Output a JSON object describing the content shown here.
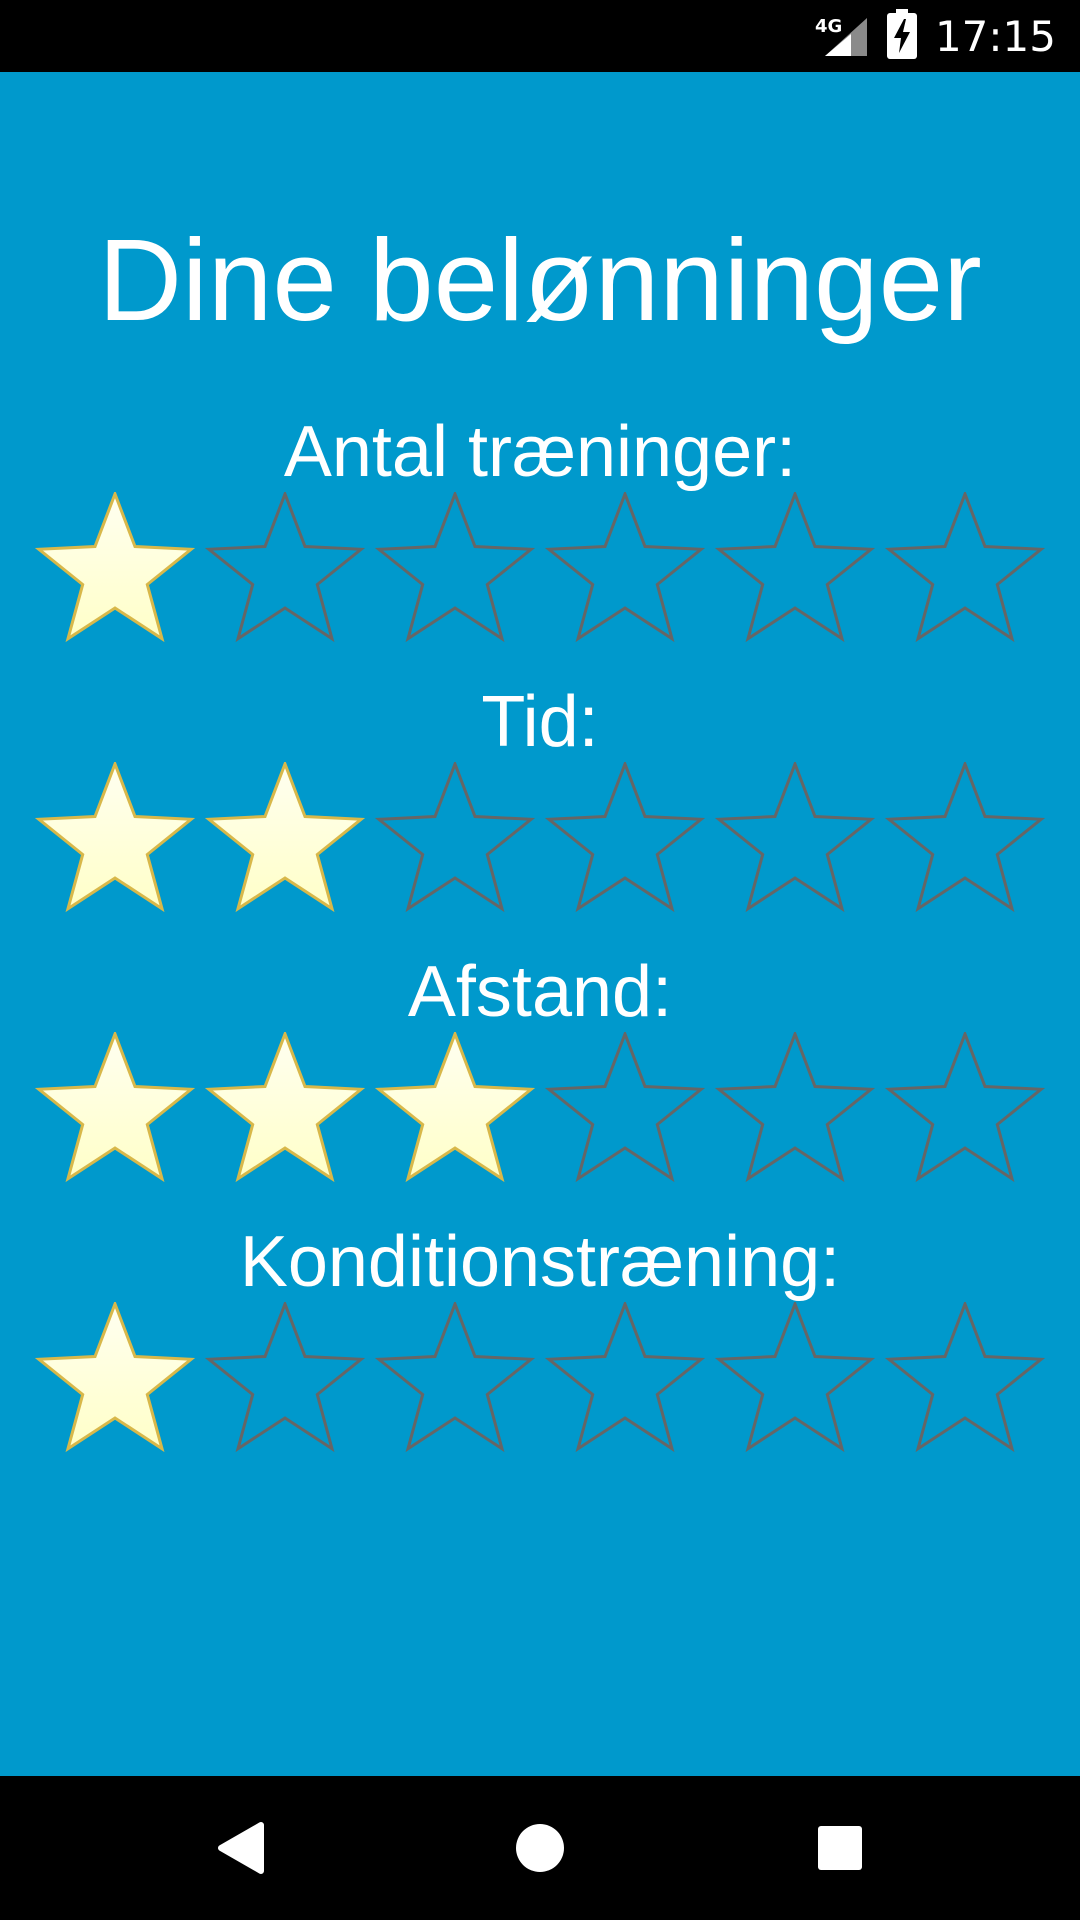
{
  "status_bar": {
    "network_type": "4G",
    "time": "17:15",
    "icons": [
      "signal-icon",
      "battery-charging-icon"
    ]
  },
  "screen": {
    "title": "Dine belønninger",
    "background_color": "#0099cc",
    "star_filled_color": "#ffffc8",
    "star_empty_stroke": "#666666"
  },
  "rewards": [
    {
      "label": "Antal træninger:",
      "earned": 1,
      "total": 6
    },
    {
      "label": "Tid:",
      "earned": 2,
      "total": 6
    },
    {
      "label": "Afstand:",
      "earned": 3,
      "total": 6
    },
    {
      "label": "Konditionstræning:",
      "earned": 1,
      "total": 6
    }
  ],
  "nav_bar": {
    "buttons": [
      "back-icon",
      "home-icon",
      "recents-icon"
    ]
  }
}
